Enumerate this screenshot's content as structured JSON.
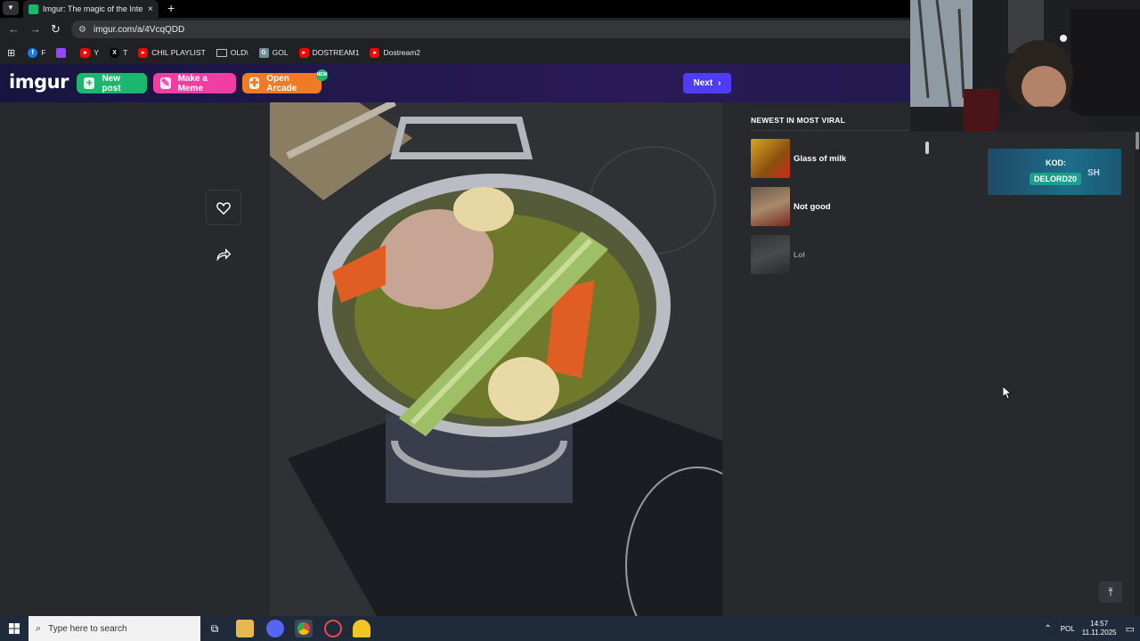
{
  "browser": {
    "tab_title": "Imgur: The magic of the Internet",
    "tab_close": "×",
    "new_tab": "+",
    "url": "imgur.com/a/4VcqQDD",
    "bookmarks": [
      {
        "label": "F",
        "color": "#1877f2"
      },
      {
        "label": "",
        "color": "#9146ff"
      },
      {
        "label": "Y",
        "color": "#ff0000"
      },
      {
        "label": "T",
        "color": "#000000"
      },
      {
        "label": "CHIL PLAYLIST",
        "color": "#ff0000"
      },
      {
        "label": "OLD\\",
        "color": "folder"
      },
      {
        "label": "GOL",
        "color": "#6b8e9b"
      },
      {
        "label": "DOSTREAM1",
        "color": "#ff0000"
      },
      {
        "label": "Dostream2",
        "color": "#ff0000"
      }
    ]
  },
  "imgur": {
    "logo": "imgur",
    "new_post": "New post",
    "make_meme": "Make a Meme",
    "open_arcade": "Open Arcade",
    "arcade_badge": "NEW",
    "next": "Next",
    "accent": "#1bb76e"
  },
  "sidebar": {
    "heading": "NEWEST IN MOST VIRAL",
    "items": [
      {
        "label": "Glass of milk"
      },
      {
        "label": "Not good"
      },
      {
        "label": "Lol"
      }
    ]
  },
  "overlay": {
    "promo_kod": "KOD:",
    "promo_code": "DELORD20",
    "promo_brand": "SH"
  },
  "taskbar": {
    "search_placeholder": "Type here to search",
    "lang": "POL",
    "time": "14:57",
    "date": "11.11.2025"
  }
}
